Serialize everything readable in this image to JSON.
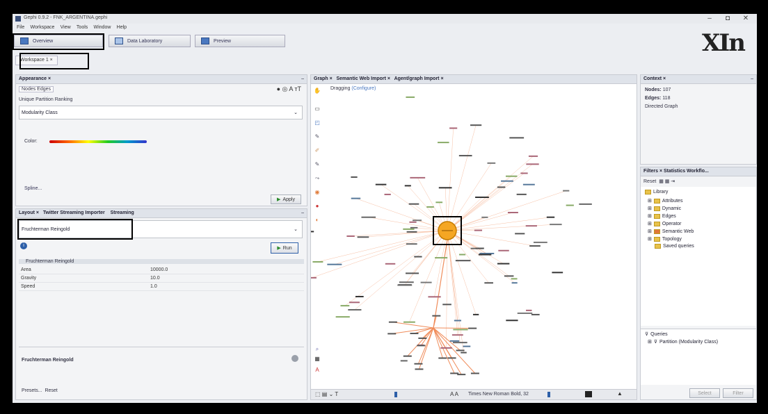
{
  "window": {
    "title": "Gephi 0.9.2 - FNK_ARGENTINA.gephi",
    "min": "–",
    "max": "◘",
    "close": "✕"
  },
  "menu": [
    "File",
    "Workspace",
    "View",
    "Tools",
    "Window",
    "Help"
  ],
  "toolbar": {
    "overview": "Overview",
    "data_lab": "Data Laboratory",
    "preview": "Preview"
  },
  "brand": "XIn",
  "workspace_tab": "Workspace 1",
  "appearance": {
    "title": "Appearance",
    "tabs": "Nodes  Edges",
    "modes": "Unique  Partition  Ranking",
    "attribute": "Modularity Class",
    "color_label": "Color:",
    "spline": "Spline...",
    "apply": "Apply"
  },
  "layout": {
    "tabs": [
      "Layout",
      "Twitter Streaming Importer",
      "Streaming"
    ],
    "algorithm": "Fruchterman Reingold",
    "run": "Run",
    "section": "Fruchterman Reingold",
    "props": [
      [
        "Area",
        "10000.0"
      ],
      [
        "Gravity",
        "10.0"
      ],
      [
        "Speed",
        "1.0"
      ]
    ],
    "desc_title": "Fruchterman Reingold",
    "presets": "Presets...",
    "reset": "Reset"
  },
  "graph": {
    "tabs": [
      "Graph",
      "Semantic Web Import",
      "Agent/graph Import"
    ],
    "dragging": "Dragging",
    "config": "(Configure)",
    "font": "Times New Roman Bold, 32"
  },
  "context": {
    "title": "Context",
    "nodes_label": "Nodes:",
    "nodes": "107",
    "edges_label": "Edges:",
    "edges": "118",
    "type": "Directed Graph"
  },
  "filters": {
    "tabs": "Filters  ×  Statistics  Workflo...",
    "reset": "Reset",
    "library": "Library",
    "items": [
      "Attributes",
      "Dynamic",
      "Edges",
      "Operator",
      "Semantic Web",
      "Topology",
      "Saved queries"
    ],
    "queries": "Queries",
    "partition": "Partition (Modularity Class)",
    "select": "Select",
    "filter": "Filter"
  },
  "colors": {
    "accent": "#f5a623",
    "edge": "#f08c5a",
    "blue": "#4a78c0"
  }
}
